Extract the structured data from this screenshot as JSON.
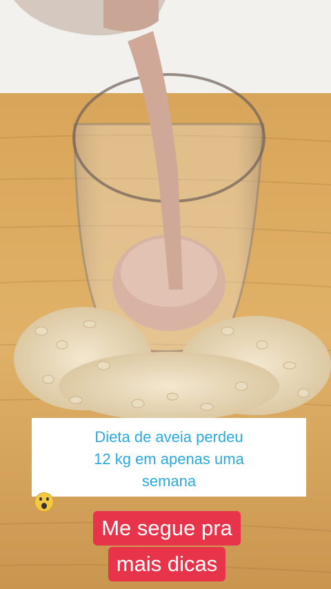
{
  "caption": {
    "line1": "Dieta de aveia perdeu",
    "line2": "12 kg em apenas uma",
    "line3": "semana",
    "emoji_icon": "scream-emoji-icon"
  },
  "cta": {
    "line1": "Me segue pra",
    "line2": "mais dicas",
    "bg_color": "#e8344a"
  },
  "colors": {
    "caption_text": "#2aa8e0",
    "board": "#d9a85a"
  }
}
